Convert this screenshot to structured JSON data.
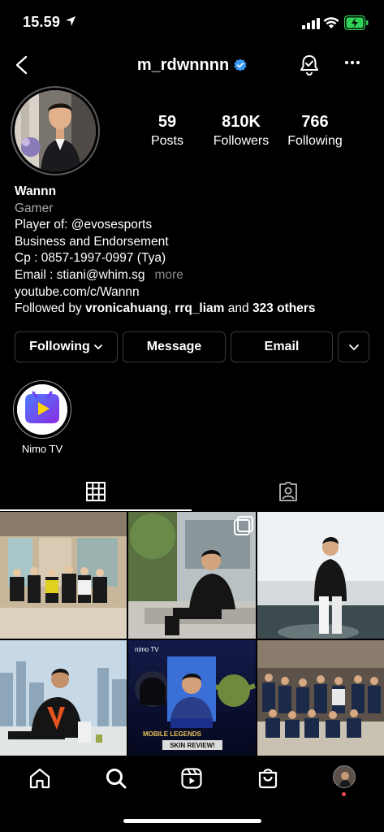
{
  "status_bar": {
    "time": "15.59"
  },
  "header": {
    "username": "m_rdwnnnn"
  },
  "stats": [
    {
      "value": "59",
      "label": "Posts"
    },
    {
      "value": "810K",
      "label": "Followers"
    },
    {
      "value": "766",
      "label": "Following"
    }
  ],
  "bio": {
    "name": "Wannn",
    "category": "Gamer",
    "line1": "Player of: @evosesports",
    "line2": "Business and Endorsement",
    "line3": "Cp : 0857-1997-0997 (Tya)",
    "line4": "Email : stiani@whim.sg",
    "more": "more",
    "link": "youtube.com/c/Wannn",
    "followed_prefix": "Followed by ",
    "followed_user1": "vronicahuang",
    "followed_sep": ", ",
    "followed_user2": "rrq_liam",
    "followed_and": " and ",
    "followed_others": "323 others"
  },
  "buttons": {
    "following": "Following",
    "message": "Message",
    "email": "Email"
  },
  "highlights": [
    {
      "label": "Nimo TV"
    }
  ],
  "posts": [
    {
      "badge_text": "",
      "title_text": "",
      "footer_text": ""
    },
    {
      "badge_text": "",
      "title_text": "",
      "footer_text": ""
    },
    {
      "badge_text": "",
      "title_text": "",
      "footer_text": ""
    },
    {
      "badge_text": "",
      "title_text": "",
      "footer_text": ""
    },
    {
      "badge_text": "nimo TV",
      "title_text": "MOBILE LEGENDS",
      "footer_text": "SKIN REVIEW!"
    },
    {
      "badge_text": "",
      "title_text": "",
      "footer_text": ""
    }
  ],
  "colors": {
    "verified": "#3897f0",
    "accent_red": "#ed4956",
    "battery": "#30d158",
    "nimo_purple": "#6b3df5"
  }
}
